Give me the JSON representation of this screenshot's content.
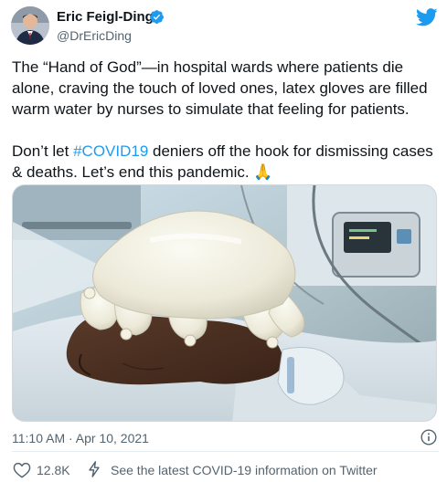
{
  "author": {
    "name": "Eric Feigl-Ding",
    "handle": "@DrEricDing",
    "avatar_icon": "profile-photo",
    "verified_icon": "verified-badge-icon"
  },
  "brand": {
    "icon": "twitter-bird-icon",
    "color": "#1d9bf0"
  },
  "tweet": {
    "line1": "The “Hand of God”—in hospital wards where patients die alone, craving the touch of loved ones, latex gloves are filled warm water by nurses to simulate that feeling for patients.",
    "line2_prefix": "Don’t let ",
    "hashtag": "#COVID19",
    "line2_suffix": " deniers off the hook for dismissing cases & deaths. Let’s end this pandemic. ",
    "emoji": "🙏"
  },
  "timestamp": "11:10 AM · Apr 10, 2021",
  "footer": {
    "like_count": "12.8K",
    "covid_info_text": "See the latest COVID-19 information on Twitter"
  },
  "colors": {
    "text": "#0f1419",
    "secondary": "#536471",
    "accent": "#1d9bf0",
    "divider": "#e6ecf0"
  }
}
